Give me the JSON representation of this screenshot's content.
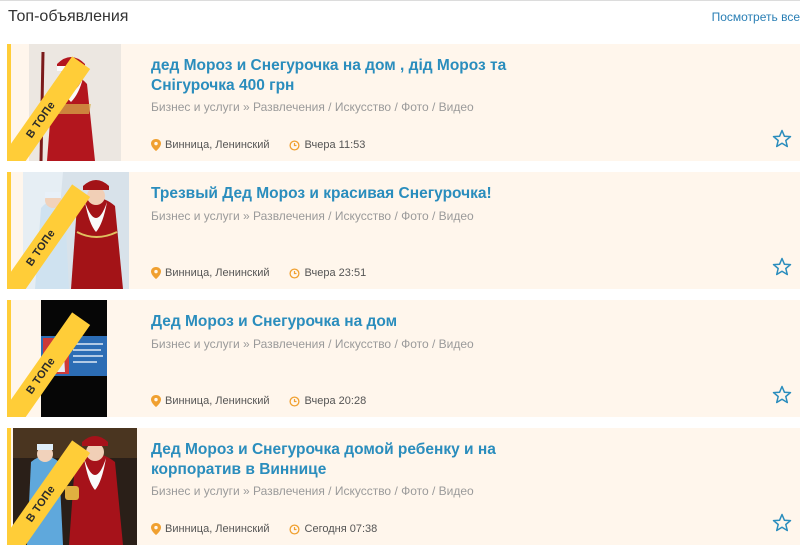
{
  "header": {
    "title": "Топ-объявления",
    "view_all": "Посмотреть все"
  },
  "badge_text": "В ТОПе",
  "colors": {
    "accent_yellow": "#ffcd38",
    "card_bg": "#fff6ec",
    "title_blue": "#2a8dbd",
    "link_blue": "#2a7fb5",
    "pin_orange": "#f0a030"
  },
  "listings": [
    {
      "title": "дед Мороз и Снегурочка на дом , дід Мороз та Снігурочка 400 грн",
      "category": "Бизнес и услуги » Развлечения / Искусство / Фото / Видео",
      "location": "Винница, Ленинский",
      "time": "Вчера 11:53"
    },
    {
      "title": "Трезвый Дед Мороз и красивая Снегурочка!",
      "category": "Бизнес и услуги » Развлечения / Искусство / Фото / Видео",
      "location": "Винница, Ленинский",
      "time": "Вчера 23:51"
    },
    {
      "title": "Дед Мороз и Снегурочка на дом",
      "category": "Бизнес и услуги » Развлечения / Искусство / Фото / Видео",
      "location": "Винница, Ленинский",
      "time": "Вчера 20:28"
    },
    {
      "title": "Дед Мороз и Снегурочка домой ребенку и на корпоратив в Виннице",
      "category": "Бизнес и услуги » Развлечения / Искусство / Фото / Видео",
      "location": "Винница, Ленинский",
      "time": "Сегодня 07:38"
    }
  ]
}
